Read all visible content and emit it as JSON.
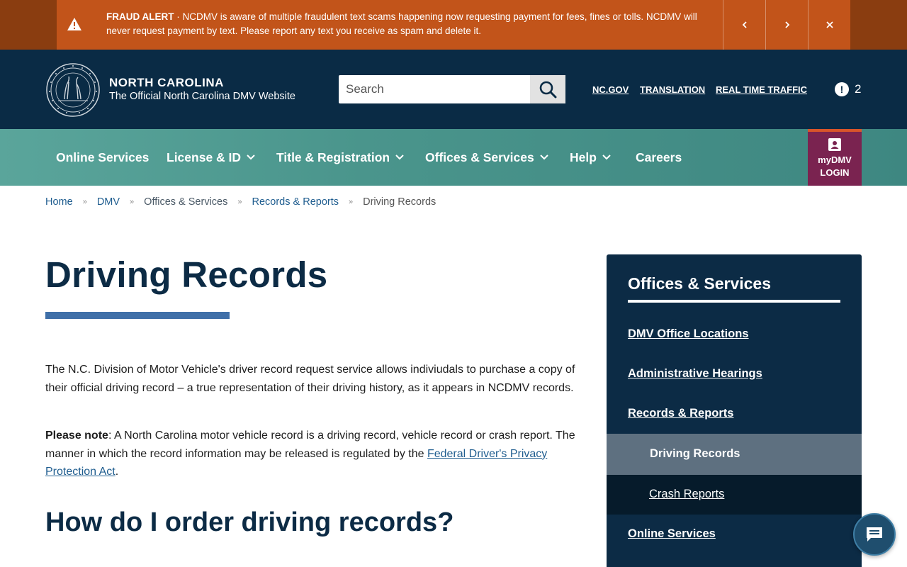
{
  "alert": {
    "label": "FRAUD ALERT",
    "separator": " · ",
    "message": "NCDMV is aware of multiple fraudulent text scams happening now requesting payment for fees, fines or tolls. NCDMV will never request payment by text. Please report any text you receive as spam and delete it.",
    "prev_icon": "chevron-left-icon",
    "next_icon": "chevron-right-icon",
    "close_icon": "close-icon",
    "warning_icon": "warning-triangle-icon"
  },
  "header": {
    "state_name": "NORTH CAROLINA",
    "subtitle": "The Official North Carolina DMV Website",
    "search_placeholder": "Search",
    "links": [
      "NC.GOV",
      "TRANSLATION",
      "REAL TIME TRAFFIC"
    ],
    "alert_count": "2",
    "alert_icon_glyph": "!"
  },
  "nav": {
    "items": [
      {
        "label": "Online Services",
        "dropdown": false
      },
      {
        "label": "License & ID",
        "dropdown": true
      },
      {
        "label": "Title & Registration",
        "dropdown": true
      },
      {
        "label": "Offices & Services",
        "dropdown": true
      },
      {
        "label": "Help",
        "dropdown": true
      },
      {
        "label": "Careers",
        "dropdown": false
      }
    ],
    "mydmv_line1": "myDMV",
    "mydmv_line2": "LOGIN"
  },
  "breadcrumb": [
    "Home",
    "DMV",
    "Offices & Services",
    "Records & Reports",
    "Driving Records"
  ],
  "breadcrumb_separator": "»",
  "main": {
    "title": "Driving Records",
    "paragraph1": "The N.C. Division of Motor Vehicle's driver record request service allows indiviudals to purchase a copy of their official driving record – a true representation of their driving history, as it appears in NCDMV records.",
    "note_label": "Please note",
    "note_text": ": A North Carolina motor vehicle record is a driving record, vehicle record or crash report. The manner in which the record information may be released is regulated by the ",
    "note_link": "Federal Driver's Privacy Protection Act",
    "note_end": ".",
    "section_title": "How do I order driving records?"
  },
  "sidebar": {
    "title": "Offices & Services",
    "links": [
      "DMV Office Locations",
      "Administrative Hearings",
      "Records & Reports"
    ],
    "active": "Driving Records",
    "sub": "Crash Reports",
    "last": "Online Services"
  },
  "colors": {
    "alert_bg": "#c2541a",
    "header_bg": "#0a2b45",
    "nav_bg": "#4a958c",
    "mydmv_bg": "#7a2350",
    "title_color": "#0c2b45",
    "link_color": "#1f5d8f"
  }
}
